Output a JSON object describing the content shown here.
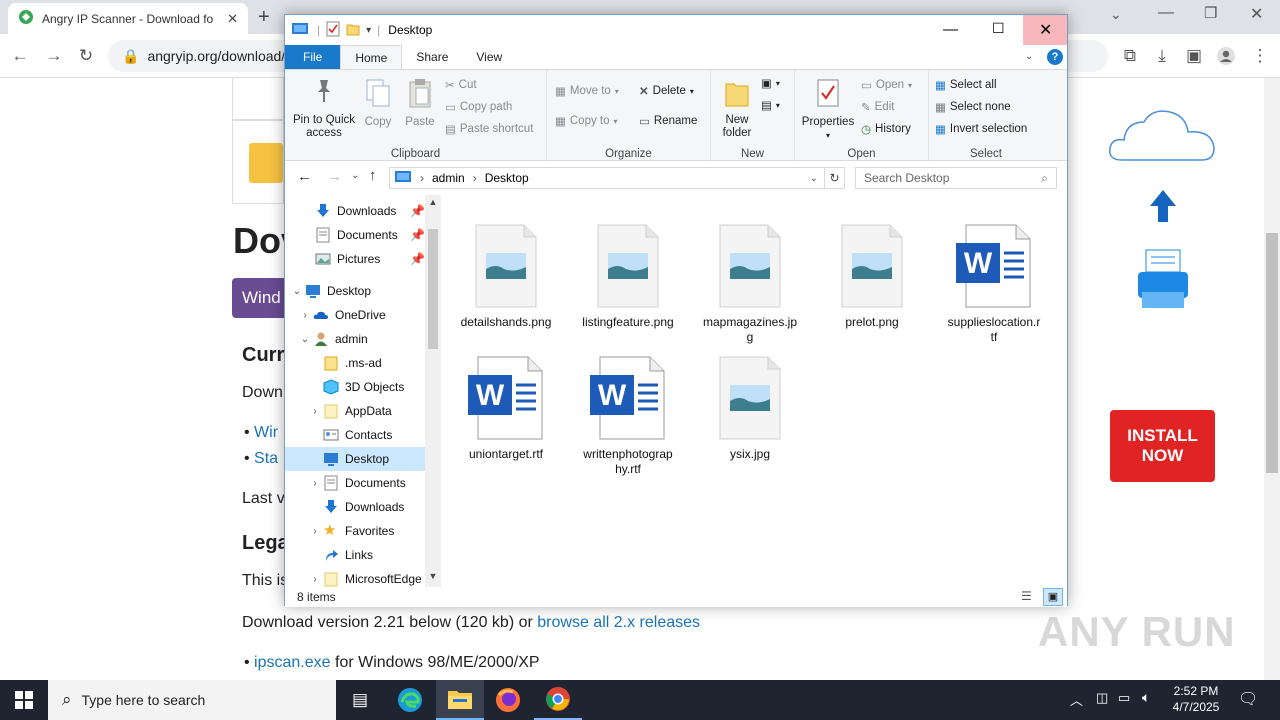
{
  "browser": {
    "tab_title": "Angry IP Scanner - Download fo",
    "url": "angryip.org/download/",
    "new_tab": "+",
    "accent": "#1a73e8"
  },
  "webpage": {
    "heading": "Dov",
    "windows_btn": "Wind",
    "section_current": "Curr",
    "download_text": "Down",
    "bullet1": "Wir",
    "bullet2": "Sta",
    "last_text": "Last v",
    "section_legacy": "Lega",
    "legacy_text": "This is",
    "download_version_prefix": "Download version 2.21 below (120 kb) or",
    "browse_link": "browse all 2.x releases",
    "ipscan_link": "ipscan.exe",
    "ipscan_suffix": "for Windows 98/ME/2000/XP",
    "install_now": "INSTALL NOW",
    "watermark": "ANY RUN"
  },
  "explorer": {
    "title": "Desktop",
    "tabs": [
      "File",
      "Home",
      "Share",
      "View"
    ],
    "ribbon": {
      "clipboard": {
        "label": "Clipboard",
        "pin": "Pin to Quick access",
        "copy": "Copy",
        "paste": "Paste",
        "cut": "Cut",
        "copy_path": "Copy path",
        "paste_shortcut": "Paste shortcut"
      },
      "organize": {
        "label": "Organize",
        "move_to": "Move to",
        "copy_to": "Copy to",
        "delete": "Delete",
        "rename": "Rename"
      },
      "new": {
        "label": "New",
        "new_folder": "New folder"
      },
      "open": {
        "label": "Open",
        "properties": "Properties",
        "open": "Open",
        "edit": "Edit",
        "history": "History"
      },
      "select": {
        "label": "Select",
        "select_all": "Select all",
        "select_none": "Select none",
        "invert": "Invert selection"
      }
    },
    "address": {
      "crumbs": [
        "admin",
        "Desktop"
      ],
      "search_placeholder": "Search Desktop"
    },
    "nav": [
      {
        "label": "Downloads",
        "pinned": true
      },
      {
        "label": "Documents",
        "pinned": true
      },
      {
        "label": "Pictures",
        "pinned": true
      },
      {
        "label": "Desktop"
      },
      {
        "label": "OneDrive"
      },
      {
        "label": "admin"
      },
      {
        "label": ".ms-ad"
      },
      {
        "label": "3D Objects"
      },
      {
        "label": "AppData"
      },
      {
        "label": "Contacts"
      },
      {
        "label": "Desktop",
        "selected": true
      },
      {
        "label": "Documents"
      },
      {
        "label": "Downloads"
      },
      {
        "label": "Favorites"
      },
      {
        "label": "Links"
      },
      {
        "label": "MicrosoftEdge"
      }
    ],
    "files": [
      {
        "name": "detailshands.png",
        "type": "image"
      },
      {
        "name": "listingfeature.png",
        "type": "image"
      },
      {
        "name": "mapmagazines.jpg",
        "type": "image"
      },
      {
        "name": "prelot.png",
        "type": "image"
      },
      {
        "name": "supplieslocation.rtf",
        "type": "word"
      },
      {
        "name": "uniontarget.rtf",
        "type": "word"
      },
      {
        "name": "writtenphotography.rtf",
        "type": "word"
      },
      {
        "name": "ysix.jpg",
        "type": "image"
      }
    ],
    "status": "8 items"
  },
  "taskbar": {
    "search_placeholder": "Type here to search",
    "time": "2:52 PM",
    "date": "4/7/2025"
  }
}
